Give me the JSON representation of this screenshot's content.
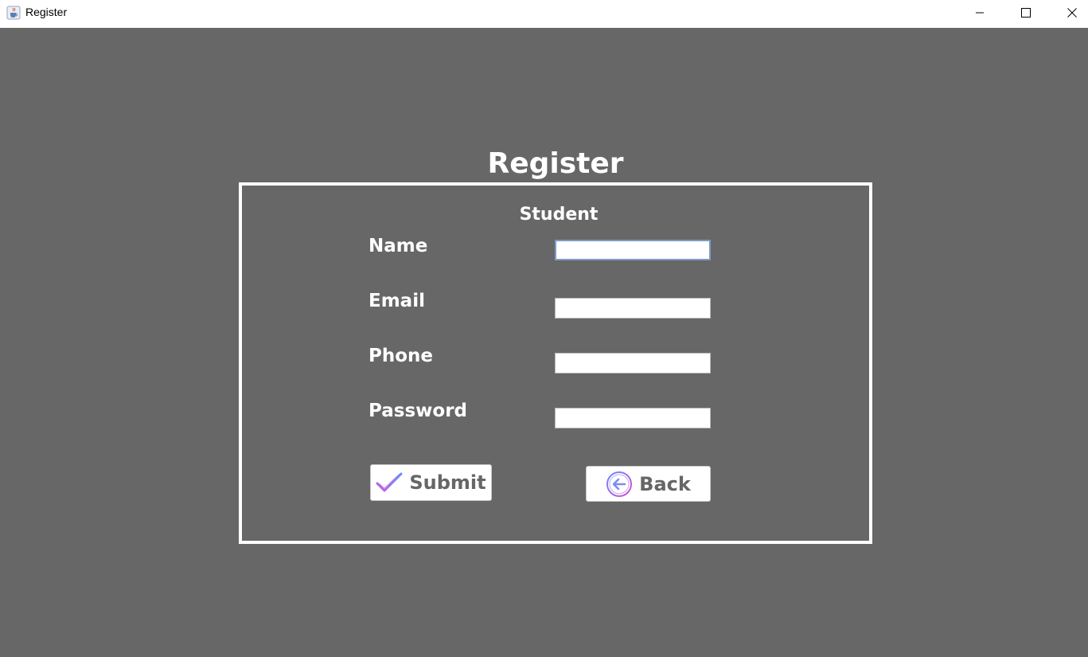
{
  "window": {
    "title": "Register",
    "icon": "java-cup-icon",
    "controls": [
      "minimize-icon",
      "maximize-icon",
      "close-icon"
    ]
  },
  "page": {
    "heading": "Register",
    "subheading": "Student",
    "background_color": "#676767",
    "text_color": "#ffffff"
  },
  "form": {
    "fields": [
      {
        "label": "Name",
        "value": "",
        "focused": true
      },
      {
        "label": "Email",
        "value": ""
      },
      {
        "label": "Phone",
        "value": ""
      },
      {
        "label": "Password",
        "value": ""
      }
    ]
  },
  "buttons": {
    "submit": {
      "label": "Submit",
      "icon": "checkmark-icon"
    },
    "back": {
      "label": "Back",
      "icon": "back-arrow-circle-icon"
    }
  }
}
